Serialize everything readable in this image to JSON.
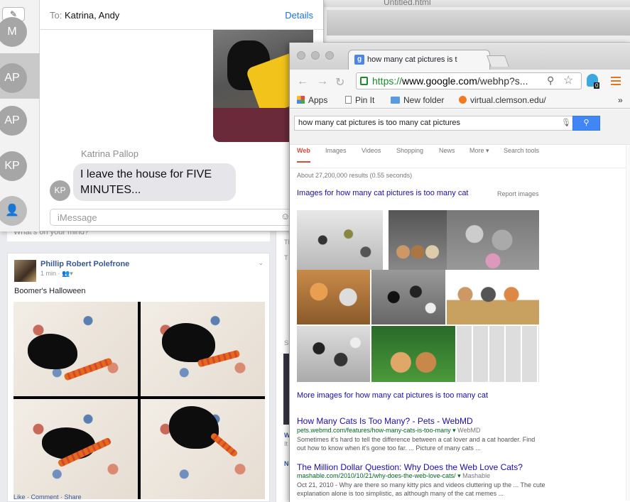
{
  "background_window": {
    "title": "Untitled.html"
  },
  "messages": {
    "to_label": "To:",
    "recipients": "Katrina,     Andy",
    "details_label": "Details",
    "contacts": [
      "M",
      "AP",
      "AP",
      "KP"
    ],
    "sender_name": "Katrina Pallop",
    "sender_initials": "KP",
    "message_text": "I leave the house for FIVE MINUTES...",
    "input_placeholder": "iMessage"
  },
  "facebook": {
    "status_placeholder": "What's on your mind?",
    "post": {
      "author": "Phillip Robert Polefrone",
      "time": "1 min",
      "caption": "Boomer's Halloween",
      "actions": "Like · Comment · Share"
    },
    "right_col_labels": [
      "TI",
      "T",
      "SI",
      "W",
      "It",
      "Ne"
    ]
  },
  "chrome": {
    "tab_title": "how many cat pictures is t",
    "url_scheme": "https://",
    "url_host": "www.google.com",
    "url_path": "/webhp?s...",
    "extension_badge": "0",
    "bookmarks": {
      "apps": "Apps",
      "pin": "Pin It",
      "folder": "New folder",
      "site": "virtual.clemson.edu/",
      "overflow": "»"
    }
  },
  "google": {
    "query": "how many cat pictures is too many cat pictures",
    "tabs": [
      "Web",
      "Images",
      "Videos",
      "Shopping",
      "News",
      "More ▾",
      "Search tools"
    ],
    "stats": "About 27,200,000 results (0.55 seconds)",
    "images_heading": "Images for how many cat pictures is too many cat",
    "report_images": "Report images",
    "more_images": "More images for how many cat pictures is too many cat",
    "results": [
      {
        "title": "How Many Cats Is Too Many? - Pets - WebMD",
        "url": "pets.webmd.com/features/how-many-cats-is-too-many",
        "source": "WebMD",
        "snippet": "Sometimes it's hard to tell the difference between a cat lover and a cat hoarder. Find out how to know when it's gone too far. ... Picture of many cats ..."
      },
      {
        "title": "The Million Dollar Question: Why Does the Web Love Cats?",
        "url": "mashable.com/2010/10/21/why-does-the-web-love-cats/",
        "source": "Mashable",
        "snippet": "Oct 21, 2010 - Why are there so many kitty pics and videos cluttering up the ... The cute explanation alone is too simplistic, as although many of the cat memes ..."
      }
    ]
  },
  "colors": {
    "google_link": "#1a0dab",
    "google_url": "#006621",
    "active_tab": "#dd4b39",
    "facebook_link": "#365899",
    "imessage_blue": "#1a73e8"
  }
}
